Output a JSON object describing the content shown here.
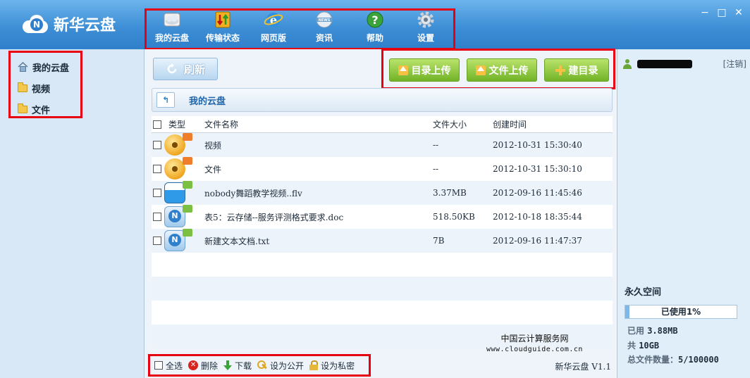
{
  "app": {
    "title": "新华云盘"
  },
  "nav": [
    {
      "label": "我的云盘",
      "icon": "cloud-drive-icon"
    },
    {
      "label": "传输状态",
      "icon": "transfer-icon"
    },
    {
      "label": "网页版",
      "icon": "ie-browser-icon"
    },
    {
      "label": "资讯",
      "icon": "news-icon"
    },
    {
      "label": "帮助",
      "icon": "help-icon"
    },
    {
      "label": "设置",
      "icon": "gear-icon"
    }
  ],
  "window": {
    "minimize": "−",
    "maximize": "□",
    "close": "✕"
  },
  "sidebar": {
    "items": [
      {
        "label": "我的云盘",
        "icon": "home-icon"
      },
      {
        "label": "视频",
        "icon": "folder-icon"
      },
      {
        "label": "文件",
        "icon": "folder-icon"
      }
    ]
  },
  "toolbar": {
    "refresh": "刷新",
    "upload_dir": "目录上传",
    "upload_file": "文件上传",
    "new_dir": "建目录"
  },
  "breadcrumb": {
    "back": "↰",
    "current": "我的云盘"
  },
  "table": {
    "headers": {
      "type": "类型",
      "name": "文件名称",
      "size": "文件大小",
      "time": "创建时间"
    },
    "rows": [
      {
        "name": "视频",
        "size": "--",
        "time": "2012-10-31 15:30:40",
        "icon": "folder-icon",
        "badge": "private-badge-icon"
      },
      {
        "name": "文件",
        "size": "--",
        "time": "2012-10-31 15:30:10",
        "icon": "folder-icon",
        "badge": "private-badge-icon"
      },
      {
        "name": "nobody舞蹈教学视频..flv",
        "size": "3.37MB",
        "time": "2012-09-16 11:45:46",
        "icon": "flv-file-icon",
        "badge": "public-badge-icon"
      },
      {
        "name": "表5：云存储--服务评测格式要求.doc",
        "size": "518.50KB",
        "time": "2012-10-18 18:35:44",
        "icon": "doc-file-icon",
        "badge": "public-badge-icon"
      },
      {
        "name": "新建文本文档.txt",
        "size": "7B",
        "time": "2012-09-16 11:47:37",
        "icon": "txt-file-icon",
        "badge": "public-badge-icon"
      }
    ]
  },
  "footer": {
    "select_all": "全选",
    "delete": "删除",
    "download": "下载",
    "set_public": "设为公开",
    "set_private": "设为私密",
    "version": "新华云盘 V1.1"
  },
  "watermark": {
    "line1": "中国云计算服务网",
    "line2": "www.cloudguide.com.cn"
  },
  "account": {
    "logout": "[注销]",
    "space_title": "永久空间",
    "used_percent_label": "已使用1%",
    "used_fraction": 0.0388,
    "used_label": "已用",
    "used_value": "3.88MB",
    "total_label": "共",
    "total_value": "10GB",
    "count_label": "总文件数量：",
    "count_value": "5/100000"
  },
  "colors": {
    "accent": "#3e8fd6",
    "highlight": "#e60012",
    "green_btn": "#72b327"
  }
}
